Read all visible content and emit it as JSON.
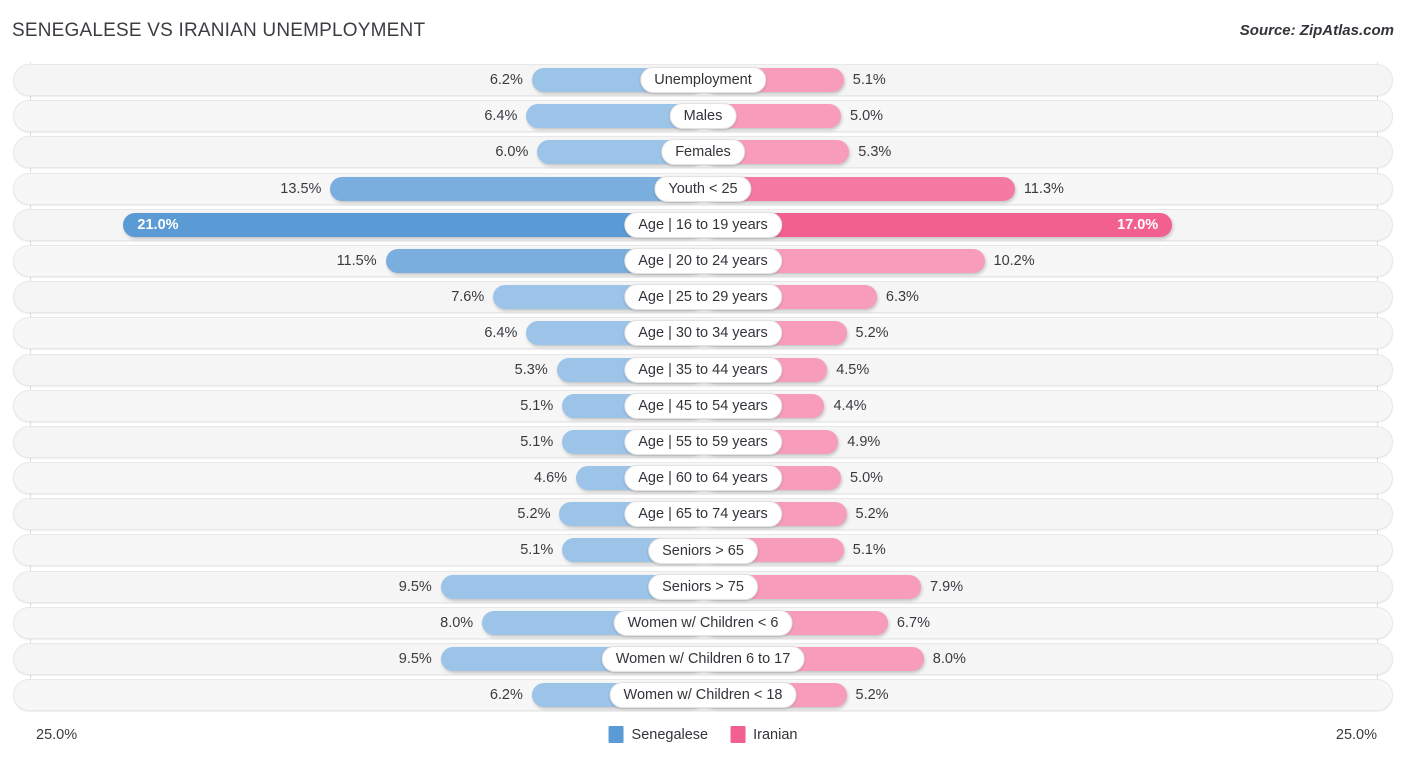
{
  "header": {
    "title": "SENEGALESE VS IRANIAN UNEMPLOYMENT",
    "source": "Source: ZipAtlas.com"
  },
  "footer": {
    "axis_min_label": "25.0%",
    "axis_max_label": "25.0%",
    "legend": [
      {
        "label": "Senegalese",
        "color": "#5b9bd5",
        "name": "legend-swatch-senegalese"
      },
      {
        "label": "Iranian",
        "color": "#f2608f",
        "name": "legend-swatch-iranian"
      }
    ]
  },
  "colors": {
    "senegalese_light": "#9cc3e8",
    "senegalese_mid": "#7aaede",
    "senegalese_strong": "#5b9bd5",
    "iranian_light": "#f79cba",
    "iranian_mid": "#f47aa4",
    "iranian_strong": "#f2608f",
    "track": "#f5f5f5",
    "gridline": "#dddddd"
  },
  "chart_data": {
    "type": "bar",
    "orientation": "horizontal-diverging",
    "title": "SENEGALESE VS IRANIAN UNEMPLOYMENT",
    "xlabel": "",
    "ylabel": "",
    "axis_max": 25.0,
    "axis_unit": "%",
    "grid": true,
    "legend_position": "bottom-center",
    "categories": [
      "Unemployment",
      "Males",
      "Females",
      "Youth < 25",
      "Age | 16 to 19 years",
      "Age | 20 to 24 years",
      "Age | 25 to 29 years",
      "Age | 30 to 34 years",
      "Age | 35 to 44 years",
      "Age | 45 to 54 years",
      "Age | 55 to 59 years",
      "Age | 60 to 64 years",
      "Age | 65 to 74 years",
      "Seniors > 65",
      "Seniors > 75",
      "Women w/ Children < 6",
      "Women w/ Children 6 to 17",
      "Women w/ Children < 18"
    ],
    "series": [
      {
        "name": "Senegalese",
        "color": "#5b9bd5",
        "values": [
          6.2,
          6.4,
          6.0,
          13.5,
          21.0,
          11.5,
          7.6,
          6.4,
          5.3,
          5.1,
          5.1,
          4.6,
          5.2,
          5.1,
          9.5,
          8.0,
          9.5,
          6.2
        ],
        "labels": [
          "6.2%",
          "6.4%",
          "6.0%",
          "13.5%",
          "21.0%",
          "11.5%",
          "7.6%",
          "6.4%",
          "5.3%",
          "5.1%",
          "5.1%",
          "4.6%",
          "5.2%",
          "5.1%",
          "9.5%",
          "8.0%",
          "9.5%",
          "6.2%"
        ]
      },
      {
        "name": "Iranian",
        "color": "#f2608f",
        "values": [
          5.1,
          5.0,
          5.3,
          11.3,
          17.0,
          10.2,
          6.3,
          5.2,
          4.5,
          4.4,
          4.9,
          5.0,
          5.2,
          5.1,
          7.9,
          6.7,
          8.0,
          5.2
        ],
        "labels": [
          "5.1%",
          "5.0%",
          "5.3%",
          "11.3%",
          "17.0%",
          "10.2%",
          "6.3%",
          "5.2%",
          "4.5%",
          "4.4%",
          "4.9%",
          "5.0%",
          "5.2%",
          "5.1%",
          "7.9%",
          "6.7%",
          "8.0%",
          "5.2%"
        ]
      }
    ]
  }
}
